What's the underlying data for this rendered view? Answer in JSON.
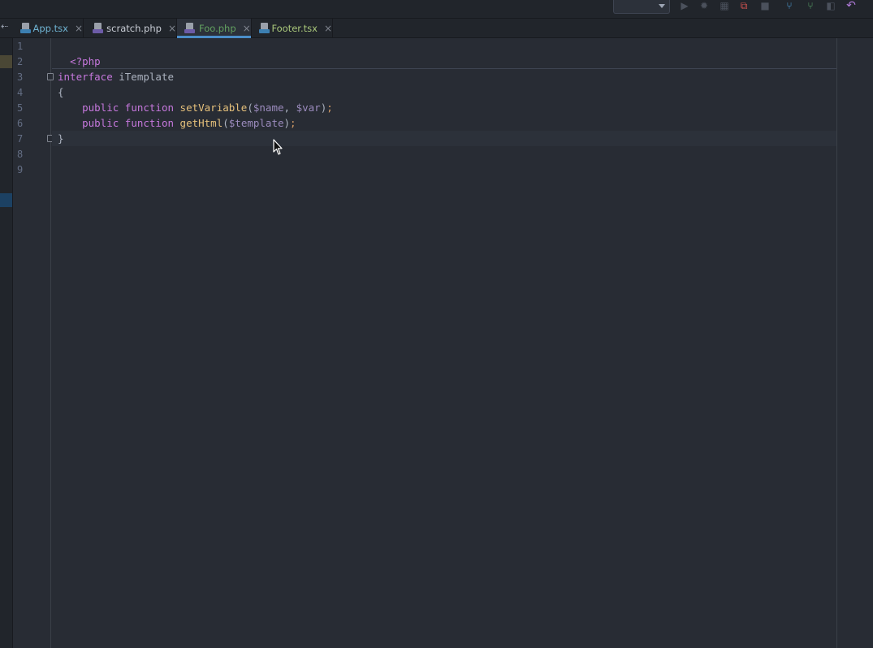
{
  "toolbar": {
    "icons": [
      "run-icon",
      "debug-icon",
      "coverage-icon",
      "profile-icon",
      "stop-icon",
      "vcs-update-icon",
      "vcs-commit-icon",
      "vcs-compare-icon",
      "undo-icon"
    ]
  },
  "tabs": [
    {
      "label": "App.tsx",
      "icon": "tsx-file-icon",
      "color": "#6fb3d2",
      "badge": "#3c7fb1",
      "active": false
    },
    {
      "label": "scratch.php",
      "icon": "php-scratch-file-icon",
      "color": "#c8ccd4",
      "badge": "#6c5ba7",
      "active": false
    },
    {
      "label": "Foo.php",
      "icon": "php-file-icon",
      "color": "#62a060",
      "badge": "#6c5ba7",
      "active": true
    },
    {
      "label": "Footer.tsx",
      "icon": "tsx-file-icon",
      "color": "#a9c77a",
      "badge": "#3c7fb1",
      "active": false
    }
  ],
  "tab_close_glyph": "×",
  "gutter": {
    "line_numbers": [
      "1",
      "2",
      "3",
      "4",
      "5",
      "6",
      "7",
      "8",
      "9"
    ]
  },
  "code": {
    "line1": {
      "open_tag": "<?php"
    },
    "line3": {
      "keyword": "interface",
      "name": " iTemplate"
    },
    "line4": {
      "text": "{"
    },
    "line5": {
      "indent": "    ",
      "kw1": "public",
      "kw2": "function",
      "fn": "setVariable",
      "p1": "(",
      "v1": "$name",
      "p2": ", ",
      "v2": "$var",
      "p3": ")",
      "semi": ";"
    },
    "line6": {
      "indent": "    ",
      "kw1": "public",
      "kw2": "function",
      "fn": "getHtml",
      "p1": "(",
      "v1": "$template",
      "p3": ")",
      "semi": ";"
    },
    "line7": {
      "text": "}"
    }
  },
  "colors": {
    "background": "#282c34",
    "keyword": "#c678dd",
    "function": "#e5c07b",
    "variable": "#9b8bbd",
    "active_tab_underline": "#4b8ec9"
  }
}
